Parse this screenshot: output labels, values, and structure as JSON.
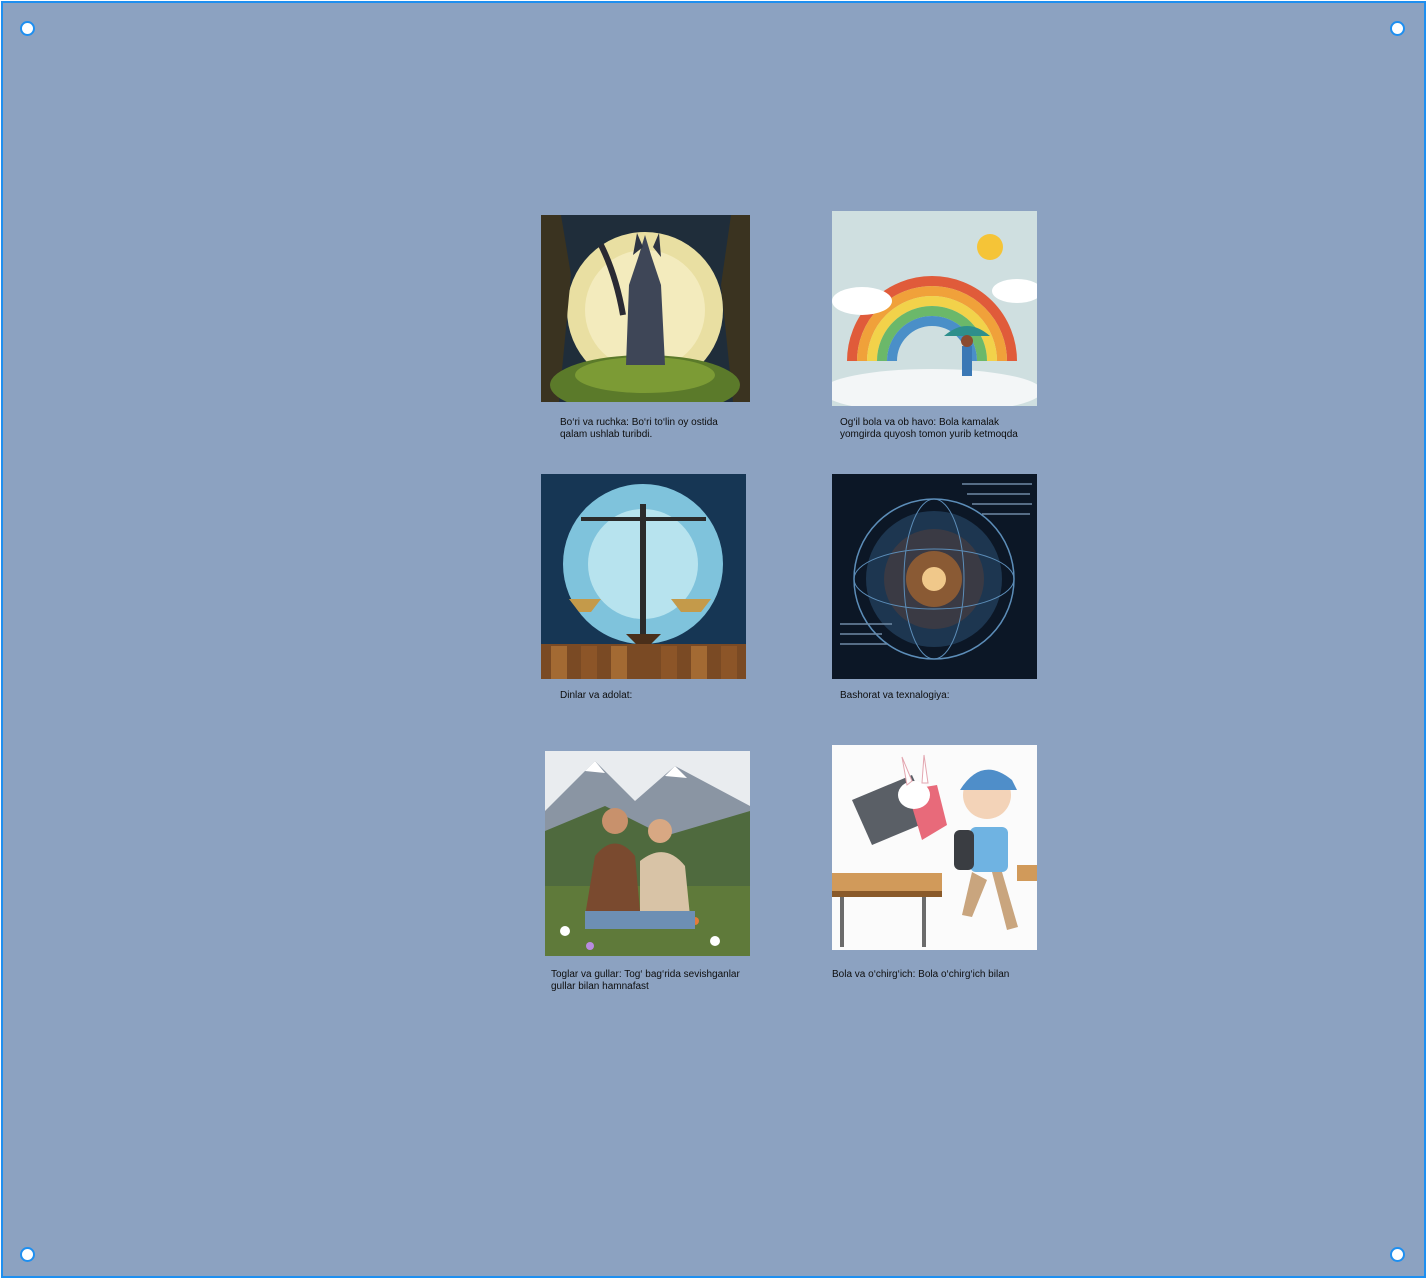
{
  "cards": [
    {
      "caption": "Bo‘ri va ruchka: Bo‘ri to‘lin oy ostida\nqalam ushlab turibdi."
    },
    {
      "caption": "Og‘il bola va ob havo: Bola kamalak\nyomgirda quyosh tomon yurib ketmoqda"
    },
    {
      "caption": "Dinlar va adolat:"
    },
    {
      "caption": "Bashorat va texnalogiya:"
    },
    {
      "caption": "Toglar va gullar:  Tog‘ bag‘rida sevishganlar\ngullar bilan hamnafast"
    },
    {
      "caption": "Bola va o‘chirg‘ich: Bola o‘chirg‘ich bilan"
    }
  ],
  "colors": {
    "canvas_background": "#8ca2c1",
    "selection_border": "#1e8ff0"
  }
}
